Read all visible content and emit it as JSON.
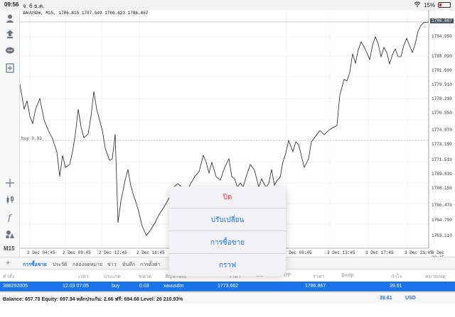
{
  "status_bar": {
    "time": "09:56",
    "date": "จ. 6 ธ.ค.",
    "battery": "15%"
  },
  "toolbar": {
    "icons": [
      "person-icon",
      "trade-icon",
      "chat-icon",
      "add-chart-icon",
      "crosshair-icon",
      "candles-icon",
      "function-icon",
      "objects-icon"
    ],
    "timeframe": "M15"
  },
  "chart": {
    "info": "XAUUSDm, M15, 1786.815 1787.649 1786.623 1786.867",
    "buy_label": "buy 0.03",
    "price_tag": "1786.867",
    "price_ticks": [
      "1784.950",
      "1783.020",
      "1781.590",
      "1779.910",
      "1778.230",
      "1776.550",
      "1774.870",
      "1773.190",
      "1771.510",
      "1769.830",
      "1768.150",
      "1766.470",
      "1764.790",
      "1763.110"
    ],
    "time_ticks": [
      "2 Dec 04:45",
      "2 Dec 08:45",
      "2 Dec 12:45",
      "2 Dec 16:45",
      "3 Dec 09:45",
      "3 Dec 13:45",
      "3 Dec 17:45",
      "3 Dec 21:45",
      "6 Dec 02:45"
    ]
  },
  "colors": {
    "accent": "#1a73e8",
    "danger": "#e53935",
    "price_line": "#222222",
    "grid": "#e6e6e6"
  },
  "tabs": {
    "items": [
      "การซื้อขาย",
      "ประวัติ",
      "กล่องจดหมาย",
      "ข่าว",
      "บันทึก",
      "การตั้งค่า"
    ],
    "active": 0
  },
  "table": {
    "headers": [
      "คำสั่ง",
      "เวลา",
      "ประเภท",
      "ขนาด",
      "สัญลักษณ์",
      "ราคา",
      "S/L",
      "T/P",
      "ราคา",
      "Swap",
      "กำไร",
      "หมายเหตุ"
    ],
    "row": {
      "ticket": "388292005",
      "time": "12.03 07:05",
      "type": "buy",
      "volume": "0.03",
      "symbol": "xauusdm",
      "open_price": "1773.662",
      "current_price": "1786.867",
      "profit": "39.61"
    }
  },
  "balance": {
    "text": "Balance: 657.73 Equity: 697.34 หลักประกัน: 2.66 ฟรี: 694.68 Level: 26 210.93%",
    "profit": "39.61",
    "currency": "USD"
  },
  "action_sheet": {
    "items": [
      {
        "label": "ปิด",
        "style": "danger"
      },
      {
        "label": "ปรับเปลี่ยน",
        "style": "default"
      },
      {
        "label": "การซื้อขาย",
        "style": "default"
      },
      {
        "label": "กราฟ",
        "style": "default"
      }
    ]
  }
}
